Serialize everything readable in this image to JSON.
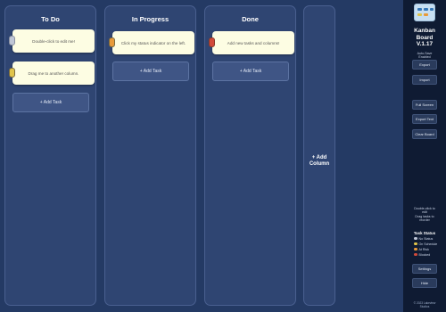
{
  "colors": {
    "background": "#243a64",
    "column_bg": "#2f4572",
    "card_bg": "#fdfde3",
    "sidebar_bg": "#0f1b33",
    "status_no_status": "#bfc6d6",
    "status_on_schedule": "#e0c44a",
    "status_at_risk": "#e89a3a",
    "status_blocked": "#d24a3a"
  },
  "columns": [
    {
      "title": "To Do",
      "cards": [
        {
          "text": "Double-click to edit me!",
          "status": "no-status"
        },
        {
          "text": "Drag me to another column.",
          "status": "on-schedule"
        }
      ],
      "add_task_label": "+ Add Task"
    },
    {
      "title": "In Progress",
      "cards": [
        {
          "text": "Click my status indicator on the left.",
          "status": "at-risk"
        }
      ],
      "add_task_label": "+ Add Task"
    },
    {
      "title": "Done",
      "cards": [
        {
          "text": "Add new tasks and columns!",
          "status": "blocked"
        }
      ],
      "add_task_label": "+ Add Task"
    }
  ],
  "add_column_label": "+ Add\nColumn",
  "sidebar": {
    "logo_icon": "kanban-logo-icon",
    "title_line1": "Kanban",
    "title_line2": "Board",
    "version": "V.1.17",
    "autosave": "Auto-Save\nEnabled",
    "buttons": {
      "export": "Export",
      "import": "Import",
      "full_screen": "Full Screen",
      "export_text": "Export Text",
      "clear_board": "Clear Board",
      "settings": "Settings",
      "hide": "Hide"
    },
    "hint": "Double-click to\nedit\nDrag tasks to\nreorder",
    "legend_title": "Task Status",
    "legend": [
      {
        "label": "No Status"
      },
      {
        "label": "On Schedule"
      },
      {
        "label": "At Risk"
      },
      {
        "label": "Blocked"
      }
    ],
    "copyright": "© 2023 Lakeview\nStudios"
  }
}
